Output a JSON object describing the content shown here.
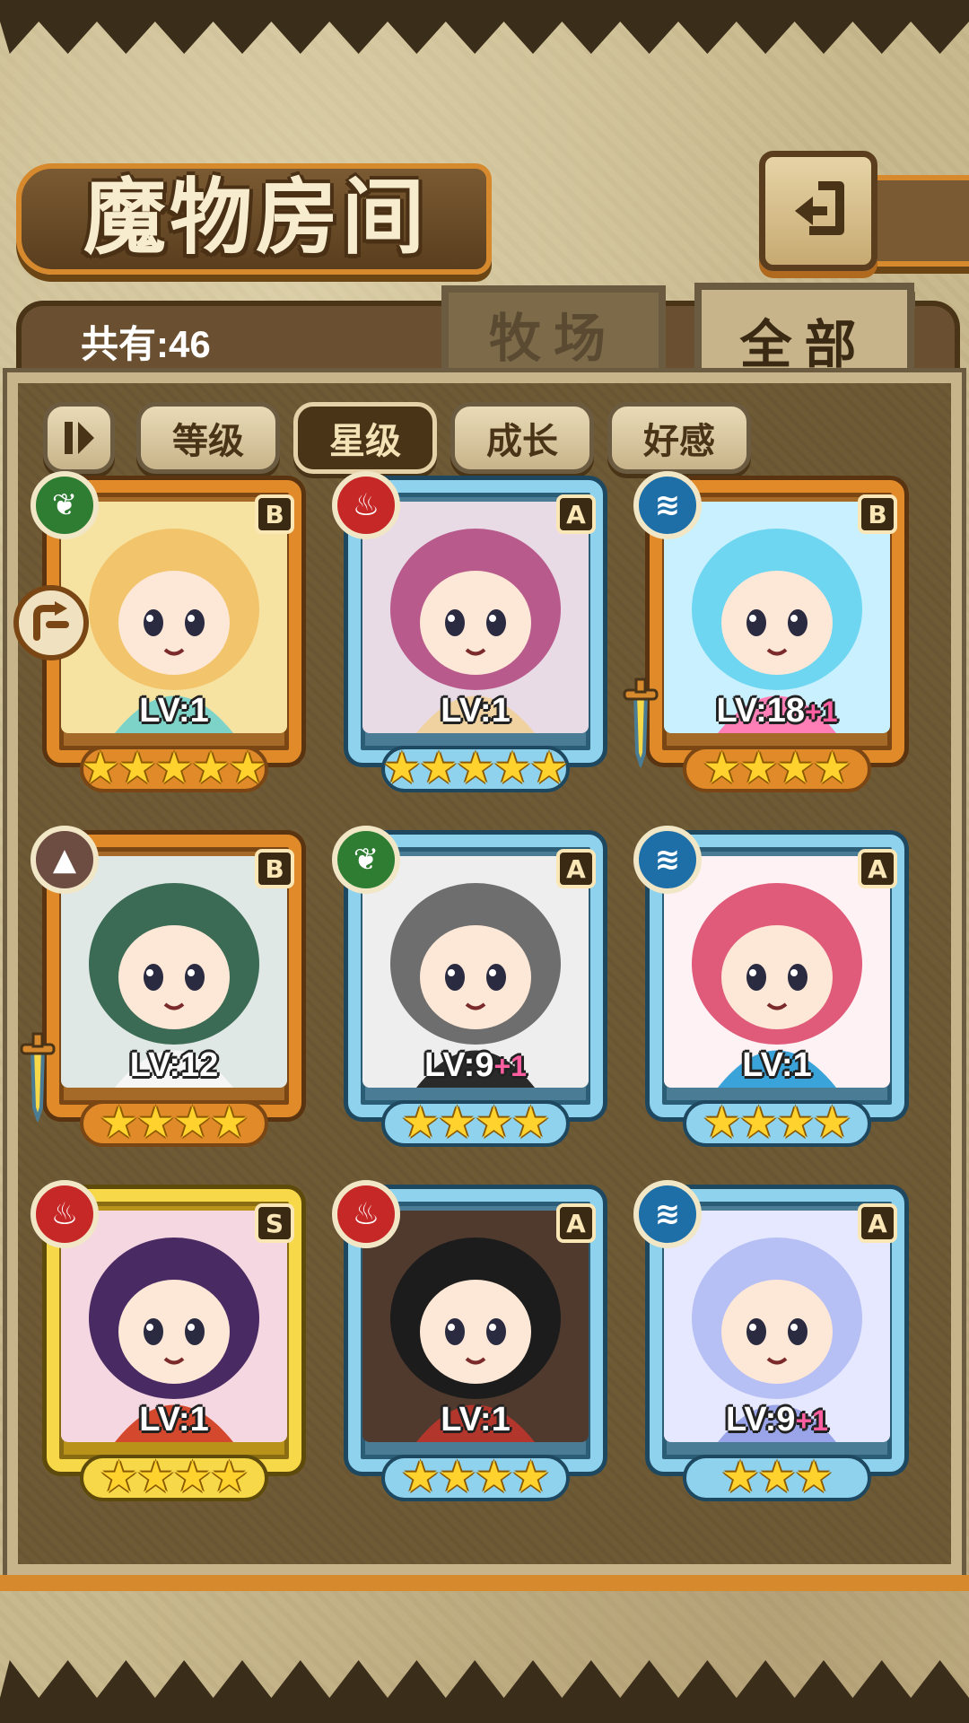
{
  "title": "魔物房间",
  "count_label": "共有:46",
  "tabs": [
    {
      "label": "牧场",
      "active": false
    },
    {
      "label": "全部",
      "active": true
    }
  ],
  "filters": [
    {
      "label": "等级",
      "active": false
    },
    {
      "label": "星级",
      "active": true
    },
    {
      "label": "成长",
      "active": false
    },
    {
      "label": "好感",
      "active": false
    }
  ],
  "icons": {
    "back": "back-arrow-icon",
    "pause": "pause-icon",
    "rotate": "rotate-arrow-icon"
  },
  "colors": {
    "orange_frame": "#e08a2a",
    "blue_frame": "#8fd2ee",
    "gold_frame": "#f6d848",
    "wind": "#2e7d32",
    "fire": "#c62828",
    "water": "#1e6fa8",
    "earth": "#6d4c41",
    "plus_text": "#ff5fa0"
  },
  "monsters": [
    {
      "element": "wind",
      "rank": "B",
      "level": "LV:1",
      "plus": "",
      "stars": 5,
      "frame": "orange",
      "has_sword": false
    },
    {
      "element": "fire",
      "rank": "A",
      "level": "LV:1",
      "plus": "",
      "stars": 5,
      "frame": "blue",
      "has_sword": false
    },
    {
      "element": "water",
      "rank": "B",
      "level": "LV:18",
      "plus": "+1",
      "stars": 4,
      "frame": "orange",
      "has_sword": true
    },
    {
      "element": "earth",
      "rank": "B",
      "level": "LV:12",
      "plus": "",
      "stars": 4,
      "frame": "orange",
      "has_sword": true
    },
    {
      "element": "wind",
      "rank": "A",
      "level": "LV:9",
      "plus": "+1",
      "stars": 4,
      "frame": "blue",
      "has_sword": false
    },
    {
      "element": "water",
      "rank": "A",
      "level": "LV:1",
      "plus": "",
      "stars": 4,
      "frame": "blue",
      "has_sword": false
    },
    {
      "element": "fire",
      "rank": "S",
      "level": "LV:1",
      "plus": "",
      "stars": 4,
      "frame": "gold",
      "has_sword": false
    },
    {
      "element": "fire",
      "rank": "A",
      "level": "LV:1",
      "plus": "",
      "stars": 4,
      "frame": "blue",
      "has_sword": false
    },
    {
      "element": "water",
      "rank": "A",
      "level": "LV:9",
      "plus": "+1",
      "stars": 3,
      "frame": "blue",
      "has_sword": false
    }
  ]
}
